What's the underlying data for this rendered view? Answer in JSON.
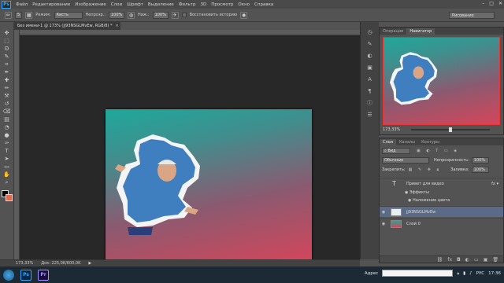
{
  "menubar": {
    "logo": "Ps",
    "items": [
      "Файл",
      "Редактирование",
      "Изображение",
      "Слои",
      "Шрифт",
      "Выделение",
      "Фильтр",
      "3D",
      "Просмотр",
      "Окно",
      "Справка"
    ],
    "controls": [
      "–",
      "□",
      "✕"
    ]
  },
  "options": {
    "brush_size": "5",
    "mode_label": "Режим:",
    "mode_value": "Кисть",
    "opacity_label": "Непрозр.:",
    "opacity_value": "100%",
    "pressure_label": "Наж.:",
    "pressure_value": "100%",
    "history_label": "Восстановить историю",
    "workspace": "Рисование"
  },
  "document": {
    "tab_title": "Без имени-1 @ 173% (jj93NSGLMvEw, RGB/8) *",
    "close": "×"
  },
  "toolbar": {
    "tools": [
      "move-icon",
      "marquee-icon",
      "lasso-icon",
      "quick-select-icon",
      "crop-icon",
      "eyedropper-icon",
      "healing-icon",
      "brush-icon",
      "stamp-icon",
      "history-brush-icon",
      "eraser-icon",
      "gradient-icon",
      "blur-icon",
      "dodge-icon",
      "pen-icon",
      "type-icon",
      "path-select-icon",
      "shape-icon",
      "hand-icon",
      "zoom-icon"
    ],
    "glyphs": [
      "✥",
      "⬚",
      "ʘ",
      "✎",
      "⌗",
      "✒",
      "✚",
      "✏",
      "⚒",
      "↺",
      "⌫",
      "▤",
      "◔",
      "●",
      "✑",
      "T",
      "➤",
      "▭",
      "✋",
      "⌕"
    ],
    "foreground_color": "#000000",
    "background_color": "#e06a4d"
  },
  "status": {
    "zoom": "173,33%",
    "doc_size": "Док: 225,0K/600,0K"
  },
  "navigator": {
    "tabs": [
      "Операции",
      "Навигатор"
    ],
    "zoom": "173,33%"
  },
  "layers": {
    "tabs": [
      "Слои",
      "Каналы",
      "Контуры"
    ],
    "filter": "Вид",
    "blend_mode": "Обычные",
    "opacity_label": "Непрозрачность:",
    "opacity_value": "100%",
    "lock_label": "Закрепить:",
    "fill_label": "Заливка:",
    "fill_value": "100%",
    "items": [
      {
        "name": "Привет для видео",
        "type": "text"
      },
      {
        "name": "Эффекты",
        "type": "effects"
      },
      {
        "name": "Наложение цвета",
        "type": "effect"
      },
      {
        "name": "jj93NSGLMvEw",
        "type": "image"
      },
      {
        "name": "Слой 0",
        "type": "image"
      }
    ]
  },
  "taskbar": {
    "apps": [
      "Ps",
      "Pr"
    ],
    "address_label": "Адрес",
    "language": "РУС",
    "time": "17:36"
  }
}
